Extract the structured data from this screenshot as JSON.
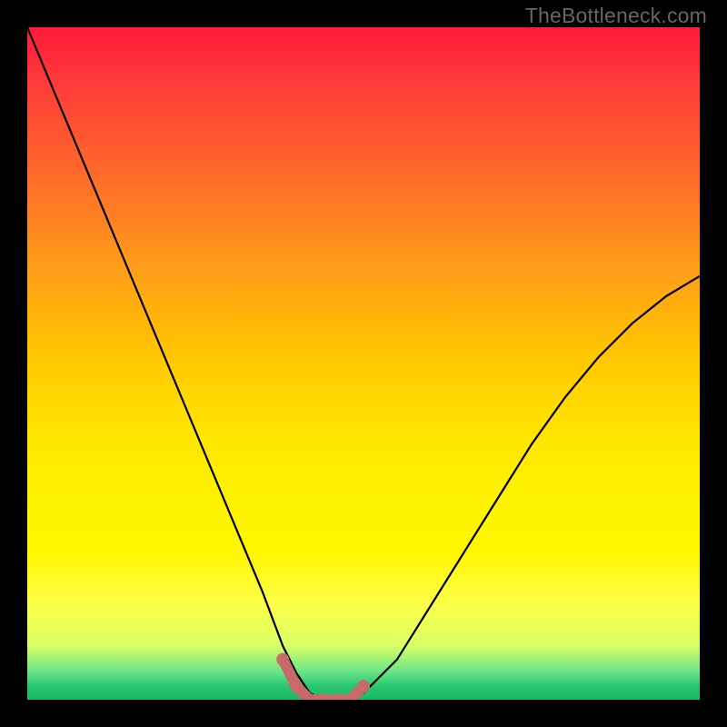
{
  "watermark": "TheBottleneck.com",
  "chart_data": {
    "type": "line",
    "title": "",
    "xlabel": "",
    "ylabel": "",
    "xlim": [
      0,
      100
    ],
    "ylim": [
      0,
      100
    ],
    "grid": false,
    "legend": false,
    "series": [
      {
        "name": "bottleneck-curve",
        "x": [
          0,
          5,
          10,
          15,
          20,
          25,
          30,
          35,
          38,
          40,
          42,
          44,
          46,
          48,
          50,
          55,
          60,
          65,
          70,
          75,
          80,
          85,
          90,
          95,
          100
        ],
        "y": [
          100,
          88,
          76,
          64,
          52,
          40,
          28,
          16,
          8,
          4,
          1,
          0,
          0,
          0,
          1,
          6,
          14,
          22,
          30,
          38,
          45,
          51,
          56,
          60,
          63
        ]
      }
    ],
    "highlight": {
      "name": "optimal-zone",
      "x": [
        38,
        40,
        42,
        44,
        46,
        48,
        50
      ],
      "y": [
        6,
        2,
        0,
        0,
        0,
        0,
        2
      ]
    }
  }
}
